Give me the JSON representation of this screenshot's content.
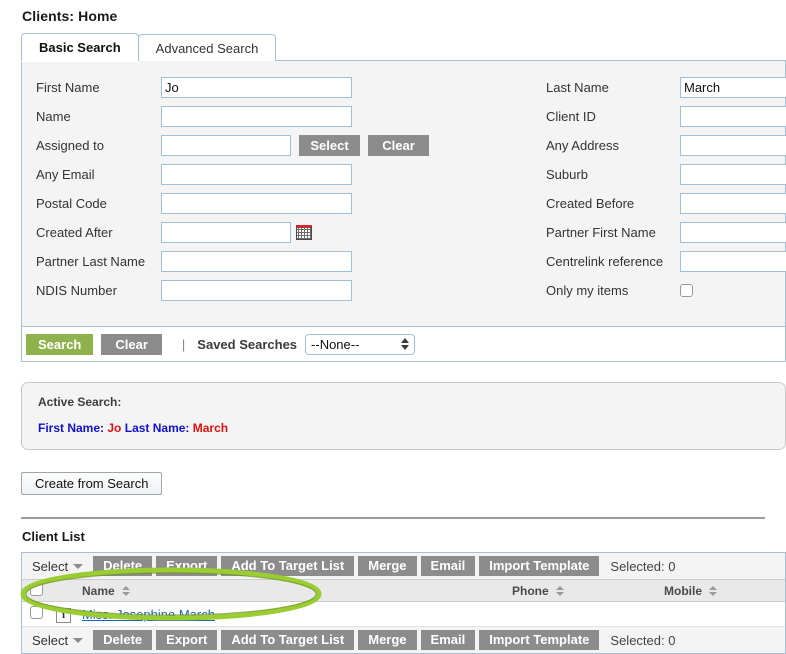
{
  "page": {
    "title": "Clients: Home"
  },
  "tabs": [
    {
      "label": "Basic Search",
      "active": true
    },
    {
      "label": "Advanced Search",
      "active": false
    }
  ],
  "search_form": {
    "left_fields": [
      {
        "label": "First Name",
        "value": "Jo",
        "type": "text"
      },
      {
        "label": "Name",
        "value": "",
        "type": "text"
      },
      {
        "label": "Assigned to",
        "value": "",
        "type": "text-with-buttons",
        "buttons": [
          "Select",
          "Clear"
        ]
      },
      {
        "label": "Any Email",
        "value": "",
        "type": "text"
      },
      {
        "label": "Postal Code",
        "value": "",
        "type": "text"
      },
      {
        "label": "Created After",
        "value": "",
        "type": "date"
      },
      {
        "label": "Partner Last Name",
        "value": "",
        "type": "text"
      },
      {
        "label": "NDIS Number",
        "value": "",
        "type": "text"
      }
    ],
    "right_fields": [
      {
        "label": "Last Name",
        "value": "March",
        "type": "text"
      },
      {
        "label": "Client ID",
        "value": "",
        "type": "text"
      },
      {
        "label": "Any Address",
        "value": "",
        "type": "text"
      },
      {
        "label": "Suburb",
        "value": "",
        "type": "text"
      },
      {
        "label": "Created Before",
        "value": "",
        "type": "date"
      },
      {
        "label": "Partner First Name",
        "value": "",
        "type": "text"
      },
      {
        "label": "Centrelink reference",
        "value": "",
        "type": "text"
      },
      {
        "label": "Only my items",
        "value": "",
        "type": "checkbox",
        "checked": false
      }
    ]
  },
  "actions": {
    "search_label": "Search",
    "clear_label": "Clear",
    "separator": "|",
    "saved_searches_label": "Saved Searches",
    "saved_searches_value": "--None--",
    "saved_searches_options": [
      "--None--"
    ]
  },
  "active_search": {
    "title": "Active Search:",
    "terms": [
      {
        "key": "First Name:",
        "value": "Jo"
      },
      {
        "key": "Last Name:",
        "value": "March"
      }
    ]
  },
  "create_from_search": {
    "label": "Create from Search"
  },
  "client_list": {
    "section_title": "Client List",
    "toolbar": {
      "select_label": "Select",
      "buttons": [
        "Delete",
        "Export",
        "Add To Target List",
        "Merge",
        "Email",
        "Import Template"
      ],
      "selected_label": "Selected: 0"
    },
    "columns": [
      {
        "label": "Name",
        "sortable": true
      },
      {
        "label": "Phone",
        "sortable": true
      },
      {
        "label": "Mobile",
        "sortable": true
      }
    ],
    "rows": [
      {
        "name": "Miss. Josephine March",
        "phone": "",
        "mobile": ""
      }
    ]
  },
  "annotation": {
    "shape": "ellipse",
    "color": "#9acd32",
    "target": "Miss. Josephine March"
  },
  "colors": {
    "search_button": "#8fb14e",
    "grey_button": "#8c8c8c",
    "link": "#1a5fbf",
    "active_search_key": "#1111cc",
    "active_search_value": "#dd1111",
    "annotation": "#9acd32"
  }
}
